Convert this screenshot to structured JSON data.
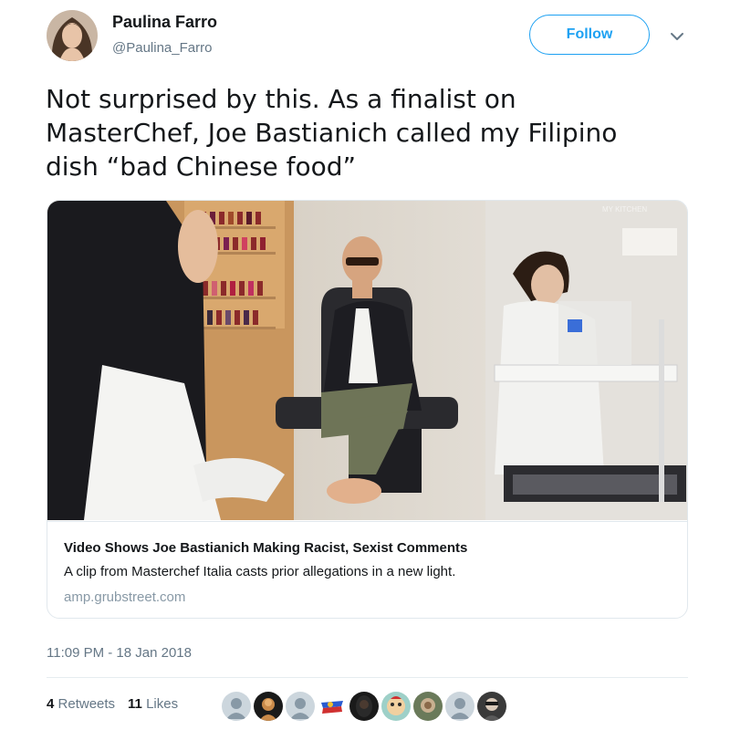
{
  "author": {
    "name": "Paulina Farro",
    "handle": "@Paulina_Farro"
  },
  "follow_label": "Follow",
  "tweet": {
    "line1": "Not surprised by this. As a finalist on",
    "line2": "MasterChef, Joe Bastianich called my Filipino",
    "line3": "dish “bad Chinese food”"
  },
  "card": {
    "title": "Video Shows Joe Bastianich Making Racist, Sexist Comments",
    "description": "A clip from Masterchef Italia casts prior allegations in a new light.",
    "url": "amp.grubstreet.com"
  },
  "timestamp": "11:09 PM - 18 Jan 2018",
  "stats": {
    "retweets_count": "4",
    "retweets_label": "Retweets",
    "likes_count": "11",
    "likes_label": "Likes"
  },
  "colors": {
    "accent": "#1da1f2",
    "secondary_text": "#657786",
    "border": "#e1e8ed"
  },
  "icons": {
    "menu": "chevron-down-icon"
  }
}
